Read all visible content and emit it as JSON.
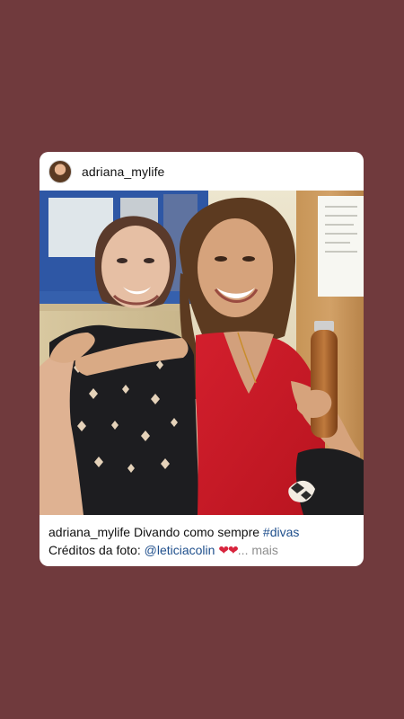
{
  "post": {
    "username": "adriana_mylife",
    "caption": {
      "username": "adriana_mylife",
      "text_before_hashtag": "Divando como sempre",
      "hashtag": "#divas",
      "credits_label": "Créditos da foto:",
      "mention": "@leticiacolin",
      "emoji": "❤❤",
      "more_label": "... mais"
    }
  },
  "colors": {
    "background": "#703a3d",
    "card": "#ffffff",
    "link": "#1f4f8c",
    "muted": "#8e8e8e",
    "heart": "#d8243d"
  },
  "icons": {
    "avatar": "profile-avatar"
  }
}
